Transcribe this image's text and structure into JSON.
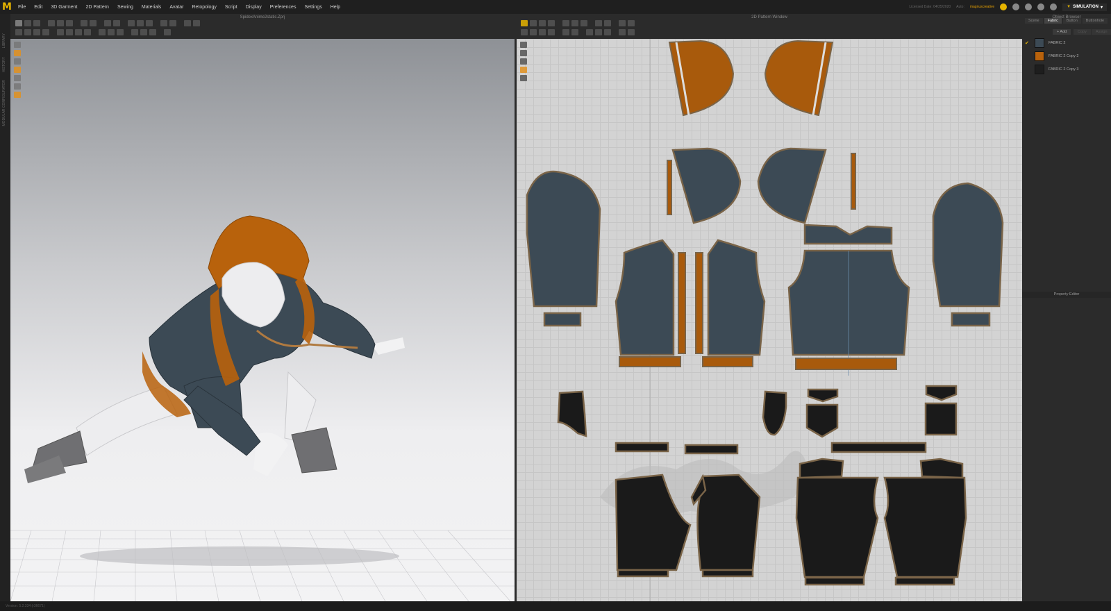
{
  "menu": {
    "items": [
      "File",
      "Edit",
      "3D Garment",
      "2D Pattern",
      "Sewing",
      "Materials",
      "Avatar",
      "Retopology",
      "Script",
      "Display",
      "Preferences",
      "Settings",
      "Help"
    ]
  },
  "license": {
    "text": "Licensed Date: 04/25/2020",
    "user_label": "Auto:",
    "user": "magnuscreative"
  },
  "mode": {
    "label": "SIMULATION"
  },
  "panel3d": {
    "title": "SpidexAnime2static.Zprj"
  },
  "panel2d": {
    "title": "2D Pattern Window"
  },
  "object_browser": {
    "title": "Object Browser",
    "tabs": [
      "Scene",
      "Fabric",
      "Button",
      "Buttonhole"
    ],
    "active_tab": "Fabric",
    "add_label": "+ Add",
    "copy_label": "Copy",
    "assign_label": "Assign",
    "fabrics": [
      {
        "name": "FABRIC 2",
        "color": "#3c4a55",
        "checked": true
      },
      {
        "name": "FABRIC 2 Copy 2",
        "color": "#b8620c",
        "checked": false
      },
      {
        "name": "FABRIC 2 Copy 3",
        "color": "#1e1e1e",
        "checked": false
      }
    ]
  },
  "property_editor": {
    "title": "Property Editor"
  },
  "side_labels": [
    "LIBRARY",
    "HISTORY",
    "MODULAR CONFIGURATOR"
  ],
  "status": {
    "text": "Version: 5.2.334 (r36671)"
  },
  "icons": [
    "logo-icon",
    "sync-icon",
    "speaker-icon",
    "user-icon",
    "help-icon",
    "settings-icon"
  ],
  "colors": {
    "navy": "#3c4a55",
    "orange": "#b8620c",
    "black": "#1a1a1a",
    "seam": "#7a6448",
    "accent": "#e6b400"
  }
}
